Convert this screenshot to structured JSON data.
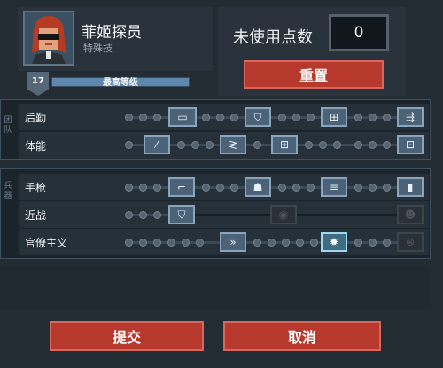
{
  "header": {
    "name": "菲姬探员",
    "subtitle": "特殊技",
    "level": "17",
    "level_text": "最高等级",
    "level_progress": 1.0
  },
  "points": {
    "label": "未使用点数",
    "value": "0",
    "reset_label": "重置"
  },
  "sections": {
    "team_tag": "团队",
    "weapon_tag": "兵器"
  },
  "skills": {
    "logistics": "后勤",
    "fitness": "体能",
    "pistol": "手枪",
    "melee": "近战",
    "bureaucracy": "官僚主义"
  },
  "footer": {
    "submit_label": "提交",
    "cancel_label": "取消"
  }
}
